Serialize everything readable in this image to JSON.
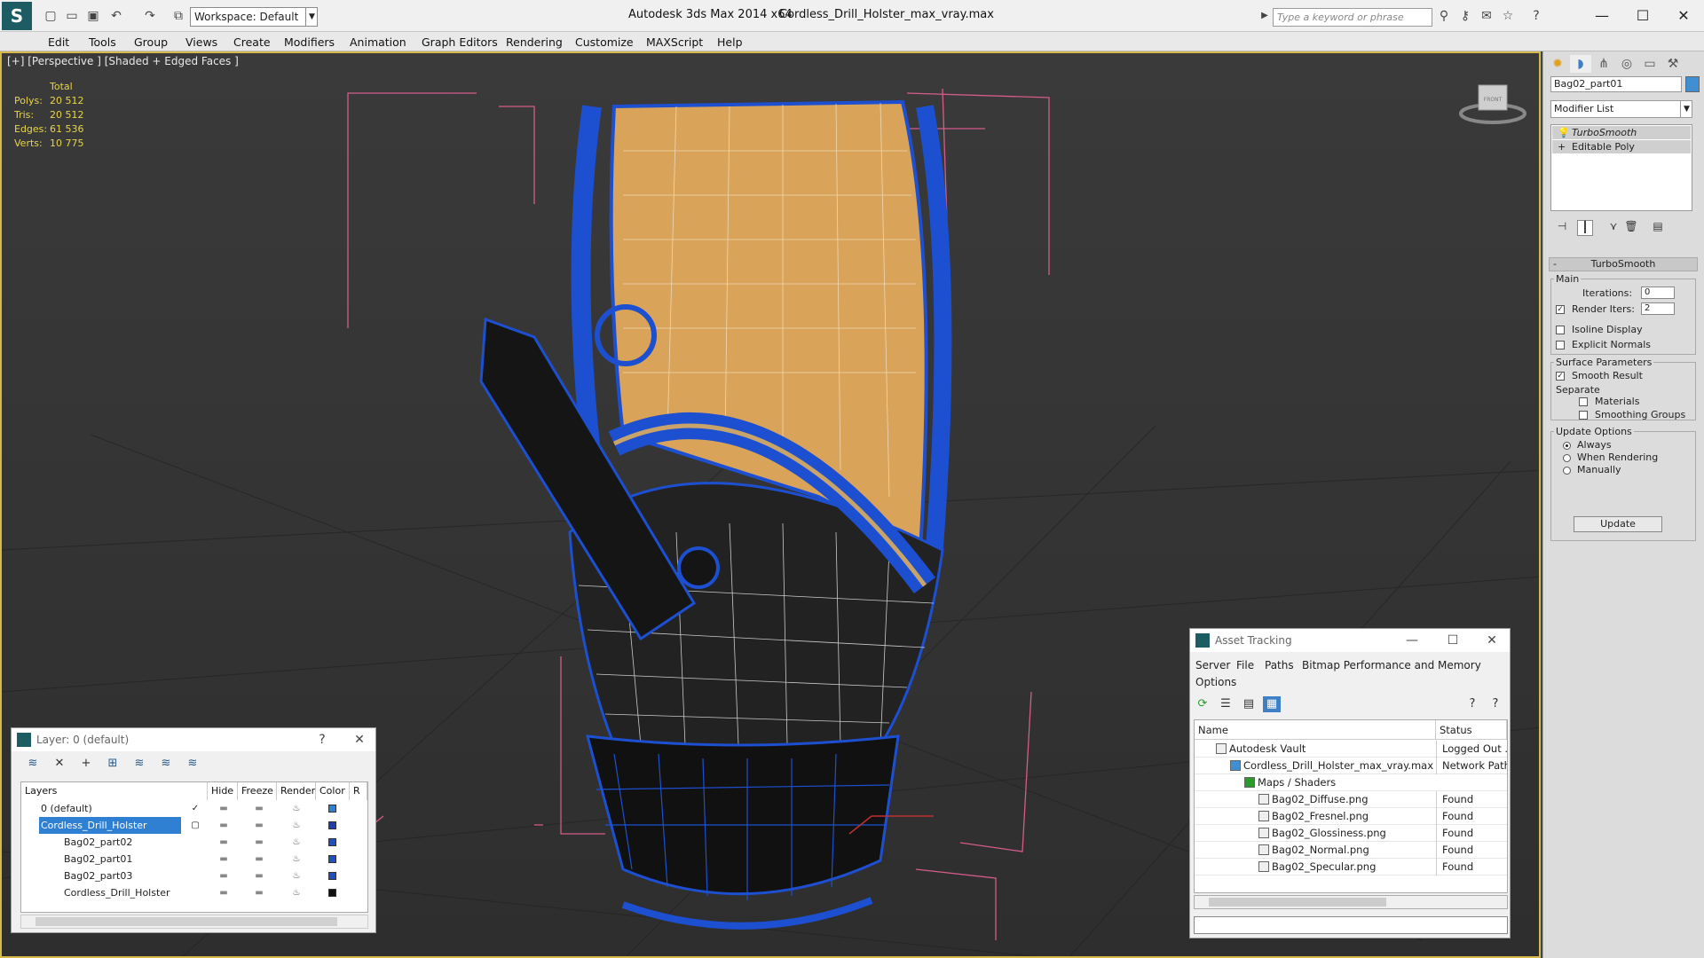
{
  "titlebar": {
    "workspace": "Workspace: Default",
    "app_title": "Autodesk 3ds Max  2014 x64",
    "file_title": "Cordless_Drill_Holster_max_vray.max",
    "search_placeholder": "Type a keyword or phrase"
  },
  "menu": [
    "Edit",
    "Tools",
    "Group",
    "Views",
    "Create",
    "Modifiers",
    "Animation",
    "Graph Editors",
    "Rendering",
    "Customize",
    "MAXScript",
    "Help"
  ],
  "viewport": {
    "label": "[+] [Perspective ] [Shaded + Edged Faces ]",
    "stats_header": "Total",
    "stats": [
      {
        "label": "Polys:",
        "value": "20 512"
      },
      {
        "label": "Tris:",
        "value": "20 512"
      },
      {
        "label": "Edges:",
        "value": "61 536"
      },
      {
        "label": "Verts:",
        "value": "10 775"
      }
    ],
    "viewcube_label": "FRONT"
  },
  "layer_panel": {
    "title": "Layer: 0 (default)",
    "help": "?",
    "columns": [
      "Layers",
      "Hide",
      "Freeze",
      "Render",
      "Color",
      "R"
    ],
    "rows": [
      {
        "name": "0 (default)",
        "color": "#2f7fd3"
      },
      {
        "name": "Cordless_Drill_Holster",
        "color": "#1f3fb0"
      },
      {
        "name": "Bag02_part02",
        "color": "#1f4fc0"
      },
      {
        "name": "Bag02_part01",
        "color": "#1f4fc0"
      },
      {
        "name": "Bag02_part03",
        "color": "#1f4fc0"
      },
      {
        "name": "Cordless_Drill_Holster",
        "color": "#111111"
      }
    ]
  },
  "asset_panel": {
    "title": "Asset Tracking",
    "menu": [
      "Server",
      "File",
      "Paths",
      "Bitmap Performance and Memory",
      "Options"
    ],
    "columns": [
      "Name",
      "Status"
    ],
    "rows": [
      {
        "name": "Autodesk Vault",
        "status": "Logged Out ..."
      },
      {
        "name": "Cordless_Drill_Holster_max_vray.max",
        "status": "Network Path"
      },
      {
        "name": "Maps / Shaders",
        "status": ""
      },
      {
        "name": "Bag02_Diffuse.png",
        "status": "Found"
      },
      {
        "name": "Bag02_Fresnel.png",
        "status": "Found"
      },
      {
        "name": "Bag02_Glossiness.png",
        "status": "Found"
      },
      {
        "name": "Bag02_Normal.png",
        "status": "Found"
      },
      {
        "name": "Bag02_Specular.png",
        "status": "Found"
      }
    ]
  },
  "command_panel": {
    "object_name": "Bag02_part01",
    "modifier_list": "Modifier List",
    "stack": [
      "TurboSmooth",
      "Editable Poly"
    ],
    "rollout_title": "TurboSmooth",
    "main_label": "Main",
    "iterations_label": "Iterations:",
    "iterations_value": "0",
    "render_iters_label": "Render Iters:",
    "render_iters_value": "2",
    "isoline_label": "Isoline Display",
    "explicit_normals_label": "Explicit Normals",
    "surface_params_label": "Surface Parameters",
    "smooth_result_label": "Smooth Result",
    "separate_label": "Separate",
    "materials_label": "Materials",
    "smoothing_groups_label": "Smoothing Groups",
    "update_options_label": "Update Options",
    "always_label": "Always",
    "when_rendering_label": "When Rendering",
    "manually_label": "Manually",
    "update_button": "Update"
  }
}
